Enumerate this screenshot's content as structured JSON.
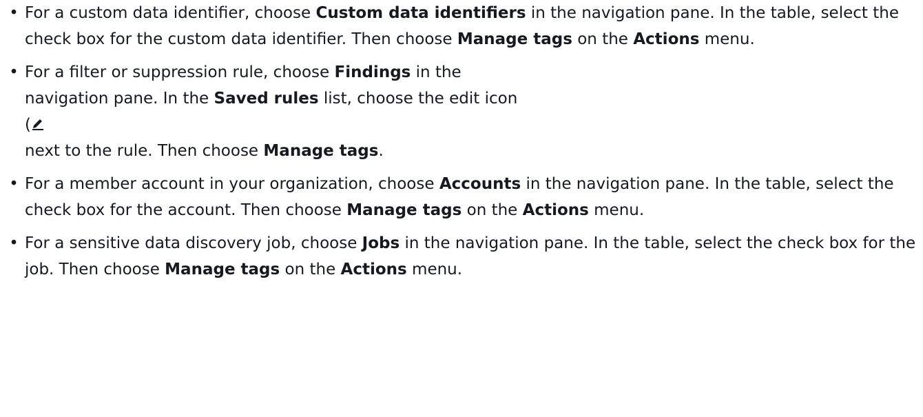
{
  "items": [
    {
      "p1": "For a custom data identifier, choose ",
      "b1": "Custom data identifiers",
      "p2": " in the navigation pane. In the table, select the check box for the custom data identifier. Then choose ",
      "b2": "Manage tags",
      "p3": " on the ",
      "b3": "Actions",
      "p4": " menu."
    },
    {
      "p1": "For a filter or suppression rule, choose ",
      "b1": "Findings",
      "p2": " in the",
      "p3": "navigation pane. In the ",
      "b2": "Saved rules",
      "p4": " list, choose the edit icon",
      "p5": "(",
      "icon": "edit-pencil-icon",
      "p6": "next to the rule. Then choose ",
      "b3": "Manage tags",
      "p7": "."
    },
    {
      "p1": "For a member account in your organization, choose ",
      "b1": "Accounts",
      "p2": " in the navigation pane. In the table, select the check box for the account. Then choose ",
      "b2": "Manage tags",
      "p3": " on the ",
      "b3": "Actions",
      "p4": " menu."
    },
    {
      "p1": "For a sensitive data discovery job, choose ",
      "b1": "Jobs",
      "p2": " in the navigation pane. In the table, select the check box for the job. Then choose ",
      "b2": "Manage tags",
      "p3": " on the ",
      "b3": "Actions",
      "p4": " menu."
    }
  ]
}
